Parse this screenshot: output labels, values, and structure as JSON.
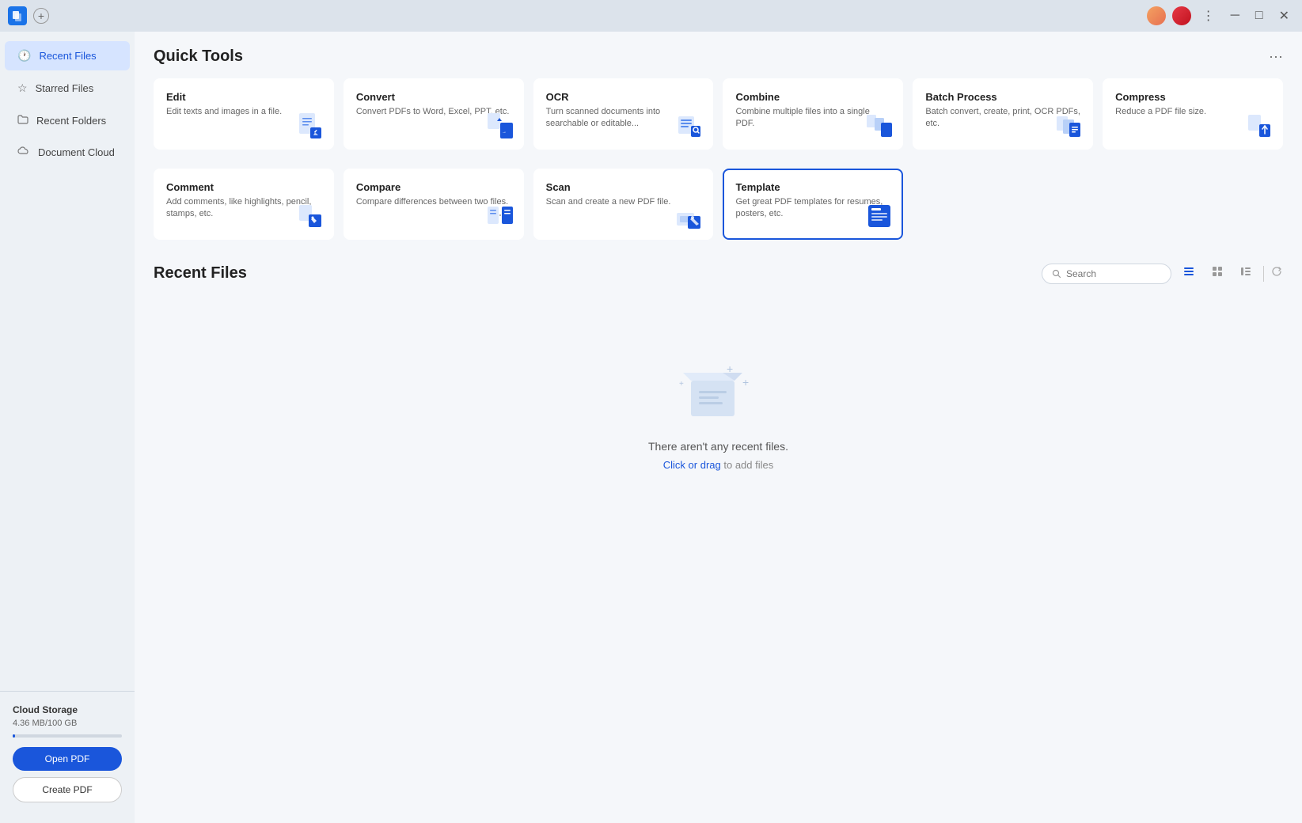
{
  "titlebar": {
    "plus_label": "+",
    "min_btn": "─",
    "max_btn": "□",
    "close_btn": "✕",
    "menu_dots": "⋮"
  },
  "sidebar": {
    "items": [
      {
        "id": "recent-files",
        "label": "Recent Files",
        "icon": "🕐",
        "active": true
      },
      {
        "id": "starred-files",
        "label": "Starred Files",
        "icon": "☆",
        "active": false
      },
      {
        "id": "recent-folders",
        "label": "Recent Folders",
        "icon": "📁",
        "active": false
      },
      {
        "id": "document-cloud",
        "label": "Document Cloud",
        "icon": "☁",
        "active": false
      }
    ],
    "cloud_storage": {
      "title": "Cloud Storage",
      "usage": "4.36 MB/100 GB"
    },
    "open_pdf_label": "Open PDF",
    "create_pdf_label": "Create PDF"
  },
  "quick_tools": {
    "title": "Quick Tools",
    "more_icon": "···",
    "tools": [
      {
        "id": "edit",
        "title": "Edit",
        "description": "Edit texts and images in a file.",
        "icon_color": "#4a7fe8"
      },
      {
        "id": "convert",
        "title": "Convert",
        "description": "Convert PDFs to Word, Excel, PPT, etc.",
        "icon_color": "#4a7fe8"
      },
      {
        "id": "ocr",
        "title": "OCR",
        "description": "Turn scanned documents into searchable or editable...",
        "icon_color": "#4a7fe8"
      },
      {
        "id": "combine",
        "title": "Combine",
        "description": "Combine multiple files into a single PDF.",
        "icon_color": "#4a7fe8"
      },
      {
        "id": "batch-process",
        "title": "Batch Process",
        "description": "Batch convert, create, print, OCR PDFs, etc.",
        "icon_color": "#4a7fe8"
      },
      {
        "id": "compress",
        "title": "Compress",
        "description": "Reduce a PDF file size.",
        "icon_color": "#4a7fe8"
      },
      {
        "id": "comment",
        "title": "Comment",
        "description": "Add comments, like highlights, pencil, stamps, etc.",
        "icon_color": "#4a7fe8"
      },
      {
        "id": "compare",
        "title": "Compare",
        "description": "Compare differences between two files.",
        "icon_color": "#4a7fe8"
      },
      {
        "id": "scan",
        "title": "Scan",
        "description": "Scan and create a new PDF file.",
        "icon_color": "#4a7fe8"
      },
      {
        "id": "template",
        "title": "Template",
        "description": "Get great PDF templates for resumes, posters, etc.",
        "icon_color": "#4a7fe8",
        "active": true
      }
    ]
  },
  "recent_files": {
    "title": "Recent Files",
    "search_placeholder": "Search",
    "empty_title": "There aren't any recent files.",
    "empty_subtitle_static": "to add files",
    "empty_link_text": "Click or drag"
  }
}
